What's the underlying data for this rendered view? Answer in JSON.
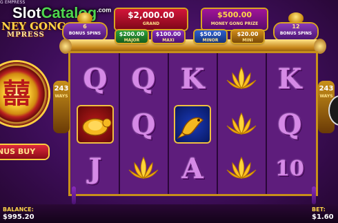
{
  "game": {
    "title_bar": "G EMPRESS",
    "logo_line1": "NEY GONG",
    "logo_line2": "MPRESS"
  },
  "watermark": {
    "slot": "Slot",
    "catalog": "Catalog",
    "com": ".com"
  },
  "jackpots": {
    "grand": {
      "value": "$2,000.00",
      "label": "GRAND"
    },
    "money_gong": {
      "value": "$500.00",
      "label": "MONEY GONG PRIZE"
    },
    "major": {
      "value": "$200.00",
      "label": "MAJOR"
    },
    "maxi": {
      "value": "$100.00",
      "label": "MAXI"
    },
    "minor": {
      "value": "$50.00",
      "label": "MINOR"
    },
    "mini": {
      "value": "$20.00",
      "label": "MINI"
    }
  },
  "bonus_spins": {
    "left": {
      "count": "6",
      "label": "BONUS SPINS"
    },
    "right": {
      "count": "12",
      "label": "BONUS SPINS"
    }
  },
  "ways": {
    "left_count": "243",
    "right_count": "243",
    "label": "WAYS"
  },
  "bonus_buy": {
    "label": "NUS BUY"
  },
  "reels": [
    [
      "Q",
      "turtle",
      "J"
    ],
    [
      "Q",
      "Q",
      "lotus"
    ],
    [
      "K",
      "koi",
      "A"
    ],
    [
      "lotus",
      "lotus",
      "lotus"
    ],
    [
      "K",
      "Q",
      "10"
    ]
  ],
  "footer": {
    "balance_label": "BALANCE:",
    "balance_value": "$995.20",
    "bet_label": "BET:",
    "bet_value": "$1.60"
  },
  "colors": {
    "accent_gold": "#d9a520",
    "reel_bg": "#5e1d7c",
    "letter_pink": "#d58ae6"
  }
}
